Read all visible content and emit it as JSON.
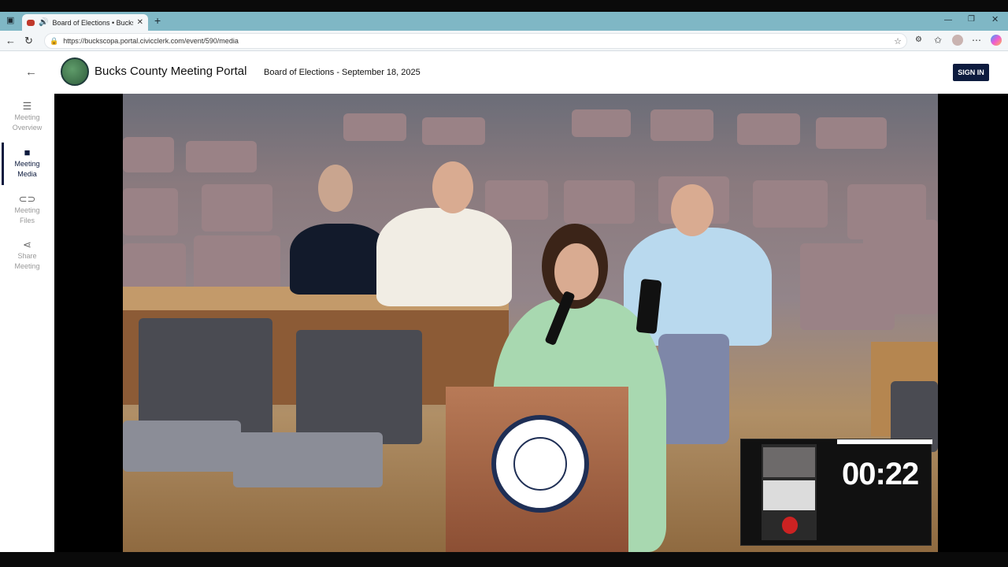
{
  "browser": {
    "tab_title": "Board of Elections • Bucks C",
    "url": "https://buckscopa.portal.civicclerk.com/event/590/media"
  },
  "header": {
    "portal_title": "Bucks County Meeting Portal",
    "meeting_title": "Board of Elections - September 18, 2025",
    "sign_in": "SIGN IN"
  },
  "sidebar": {
    "items": [
      {
        "label_1": "Meeting",
        "label_2": "Overview",
        "icon": "list-icon"
      },
      {
        "label_1": "Meeting",
        "label_2": "Media",
        "icon": "video-camera-icon"
      },
      {
        "label_1": "Meeting",
        "label_2": "Files",
        "icon": "attachment-icon"
      },
      {
        "label_1": "Share",
        "label_2": "Meeting",
        "icon": "share-icon"
      }
    ]
  },
  "video": {
    "timer": "00:22"
  }
}
